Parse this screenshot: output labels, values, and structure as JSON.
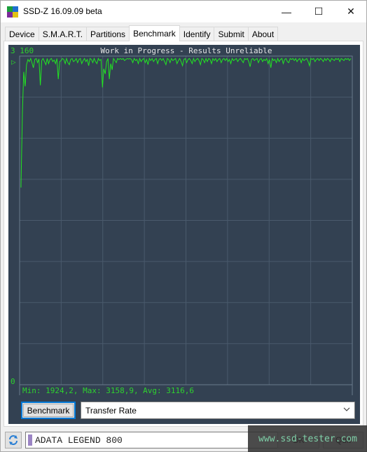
{
  "window": {
    "title": "SSD-Z 16.09.09 beta",
    "controls": {
      "minimize": "—",
      "maximize": "☐",
      "close": "✕"
    }
  },
  "tabs": [
    {
      "label": "Device",
      "active": false
    },
    {
      "label": "S.M.A.R.T.",
      "active": false
    },
    {
      "label": "Partitions",
      "active": false
    },
    {
      "label": "Benchmark",
      "active": true
    },
    {
      "label": "Identify",
      "active": false
    },
    {
      "label": "Submit",
      "active": false
    },
    {
      "label": "About",
      "active": false
    }
  ],
  "benchmark": {
    "button_label": "Benchmark",
    "mode_select": {
      "value": "Transfer Rate"
    }
  },
  "statusbar": {
    "refresh_icon": "refresh-icon",
    "drive_name": "ADATA LEGEND 800",
    "drive_color": "#9b84c4",
    "button_1_label": "OK",
    "button_2_label": "Quit"
  },
  "watermark": "www.ssd-tester.com",
  "colors": {
    "chart_bg": "#334152",
    "grid": "#4a5a6c",
    "series": "#22e622",
    "label_green": "#2ed22e",
    "title_text": "#e6e6e6"
  },
  "chart_data": {
    "type": "line",
    "title": "Work in Progress - Results Unreliable",
    "ylabel_top": "3 160",
    "ylabel_bottom": "0",
    "ylim": [
      0,
      3160
    ],
    "x_count": 240,
    "grid": true,
    "stats": "Min: 1924,2, Max: 3158,9, Avg: 3116,6",
    "series": [
      {
        "name": "Transfer Rate (MB/s)",
        "values": [
          1924,
          2630,
          3020,
          2880,
          3090,
          3140,
          3120,
          3150,
          3105,
          3060,
          3140,
          3150,
          3110,
          3145,
          2890,
          3130,
          3150,
          3120,
          3090,
          3150,
          3100,
          3140,
          3150,
          3120,
          3135,
          3100,
          3150,
          2950,
          3120,
          3130,
          3150,
          3140,
          3100,
          3150,
          3110,
          3090,
          3140,
          3150,
          3120,
          3130,
          3150,
          3110,
          3140,
          3150,
          3100,
          3130,
          3150,
          3120,
          3140,
          3080,
          3150,
          3140,
          3110,
          3150,
          3120,
          3100,
          3150,
          3130,
          3140,
          2870,
          3050,
          3000,
          3120,
          3150,
          2950,
          3100,
          3040,
          3150,
          3130,
          3110,
          3150,
          3140,
          3150,
          3140,
          3150,
          3130,
          3140,
          3150,
          3145,
          3150,
          3140,
          3110,
          3150,
          3130,
          3140,
          3100,
          3150,
          3120,
          3140,
          3150,
          3110,
          3140,
          3090,
          3150,
          3130,
          3150,
          3120,
          3140,
          3150,
          3100,
          3140,
          3150,
          3130,
          3150,
          3120,
          3090,
          3150,
          3140,
          3110,
          3150,
          3130,
          3140,
          3150,
          3100,
          3130,
          3150,
          3120,
          3080,
          3140,
          3150,
          3110,
          3140,
          3150,
          3130,
          3100,
          3150,
          3120,
          3140,
          3150,
          3130,
          3090,
          3150,
          3140,
          3110,
          3150,
          3120,
          3150,
          3140,
          3100,
          3150,
          3130,
          3150,
          3120,
          3140,
          3150,
          3110,
          3140,
          3150,
          3130,
          3150,
          3120,
          3140,
          3100,
          3150,
          3130,
          3140,
          3150,
          3120,
          3140,
          3150,
          3130,
          3110,
          3150,
          3140,
          3150,
          3120,
          3070,
          3140,
          3150,
          3130,
          3140,
          3150,
          3110,
          3140,
          3150,
          3120,
          3140,
          3130,
          3150,
          3100,
          3140,
          3060,
          3150,
          3130,
          3140,
          3110,
          3150,
          3120,
          3140,
          3150,
          3100,
          3140,
          3150,
          3120,
          3110,
          3150,
          3140,
          3150,
          3130,
          3150,
          3120,
          3140,
          3150,
          3110,
          3150,
          3130,
          3140,
          3150,
          3120,
          3080,
          3150,
          3140,
          3150,
          3120,
          3140,
          3150,
          3130,
          3150,
          3140,
          3120,
          3150,
          3130,
          3150,
          3140,
          3120,
          3150,
          3140,
          3130,
          3150,
          3140,
          3150,
          3120,
          3150,
          3140,
          3130,
          3150,
          3140,
          3150,
          3130,
          3150
        ]
      }
    ]
  }
}
